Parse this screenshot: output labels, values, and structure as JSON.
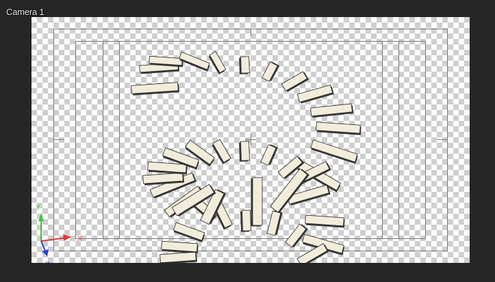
{
  "viewport": {
    "camera_label": "Camera 1"
  },
  "gizmo": {
    "y_label": "Y",
    "x_label": "X",
    "z_label": "Z",
    "y_color": "#3ec43e",
    "x_color": "#e23a3a",
    "z_color": "#2a3fd8"
  },
  "scene": {
    "object_fill": "#f2eddb",
    "object_shadow": "#3a3a3a",
    "guide_color": "#7a7a7a"
  }
}
